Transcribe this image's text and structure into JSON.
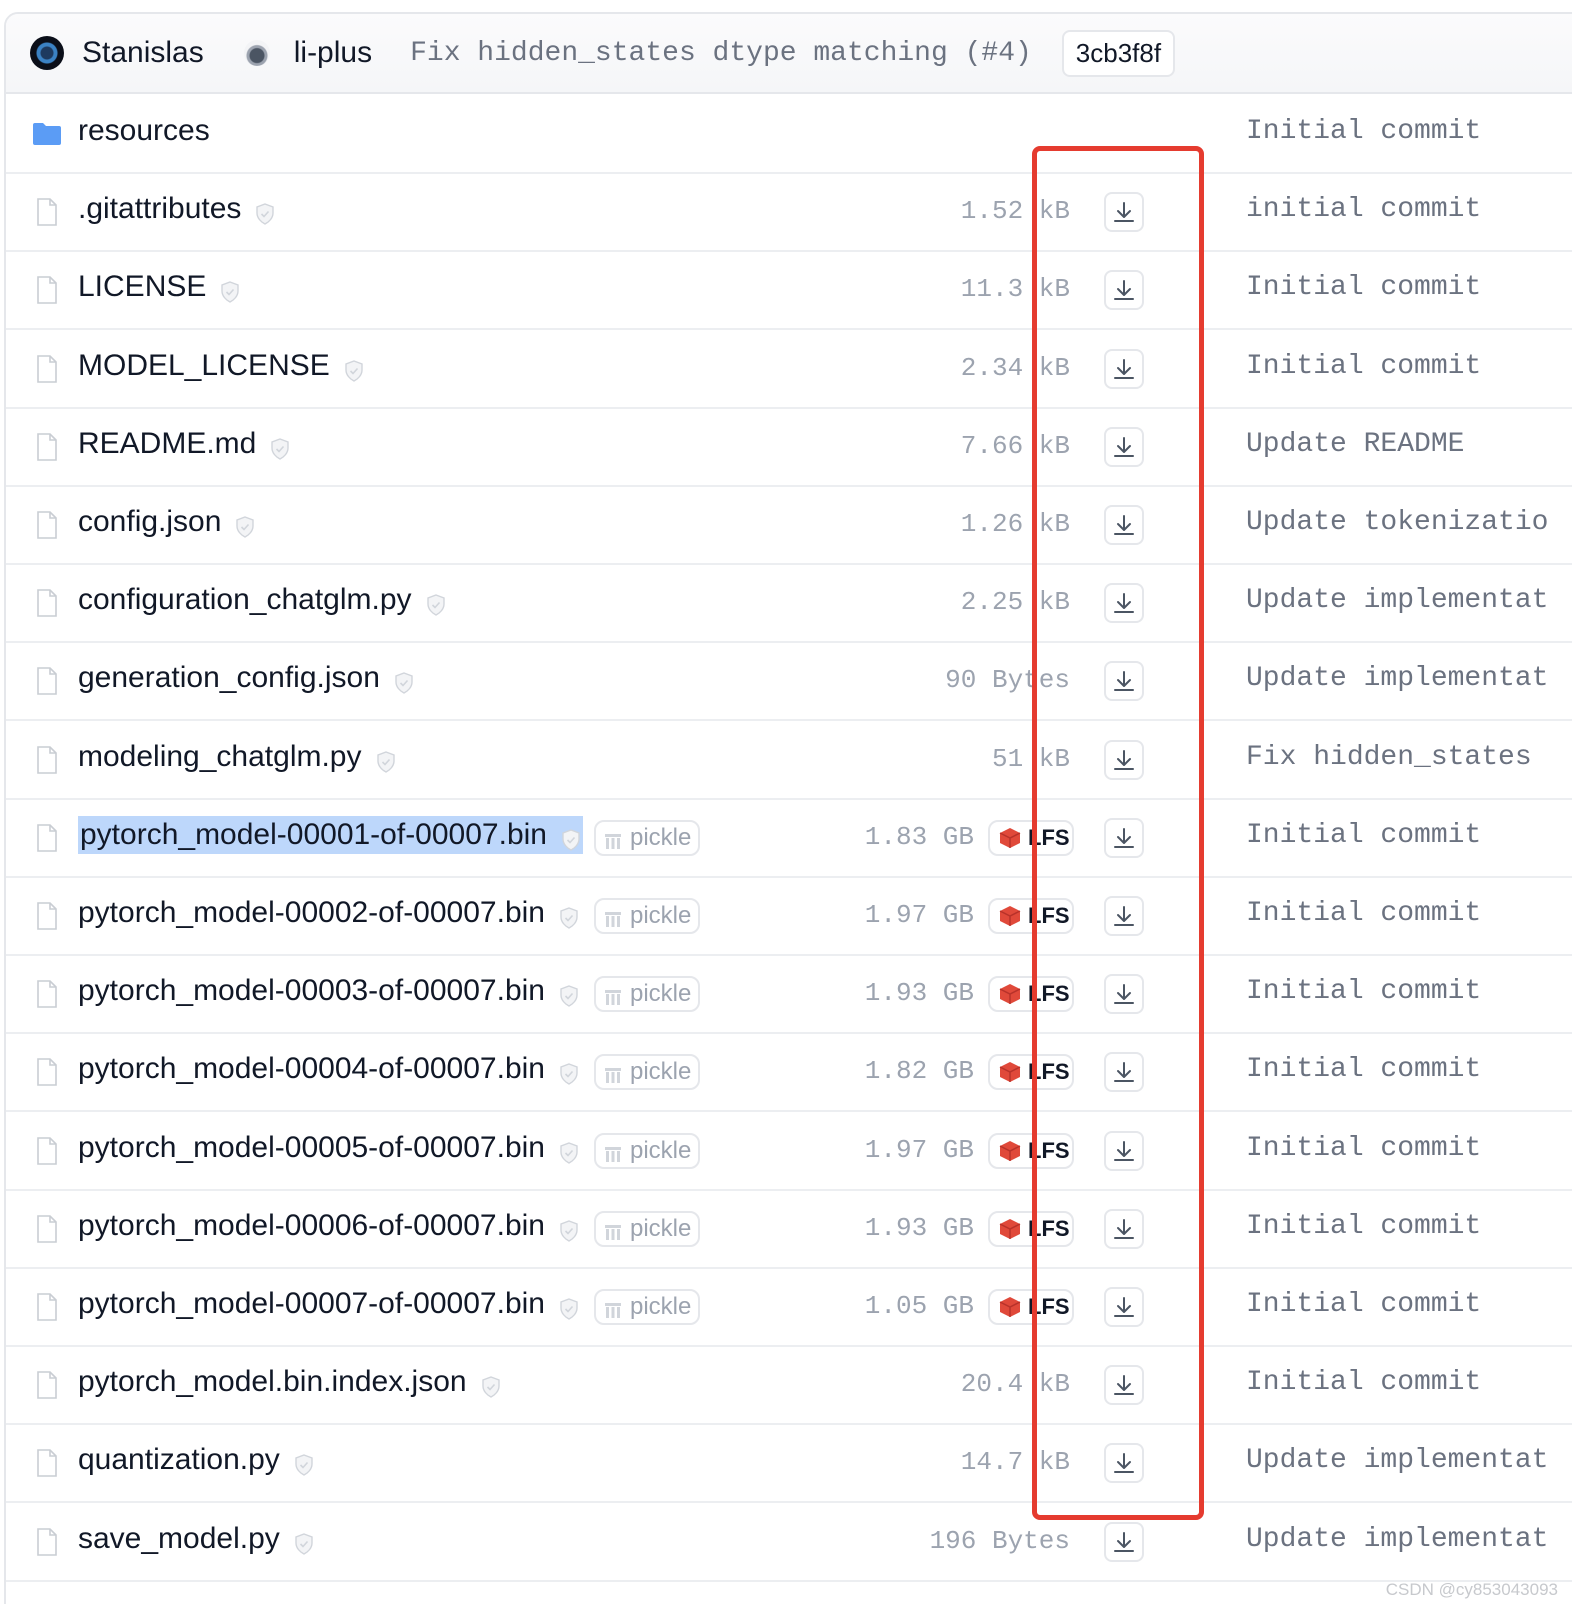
{
  "header": {
    "author1": "Stanislas",
    "author2": "li-plus",
    "commit_message": "Fix hidden_states dtype matching (#4)",
    "commit_sha": "3cb3f8f"
  },
  "files": [
    {
      "name": "resources",
      "type": "folder",
      "size": "",
      "lfs": false,
      "pickle": false,
      "message": "Initial commit",
      "selected": false
    },
    {
      "name": ".gitattributes",
      "type": "file",
      "size": "1.52 kB",
      "lfs": false,
      "pickle": false,
      "message": "initial commit",
      "selected": false
    },
    {
      "name": "LICENSE",
      "type": "file",
      "size": "11.3 kB",
      "lfs": false,
      "pickle": false,
      "message": "Initial commit",
      "selected": false
    },
    {
      "name": "MODEL_LICENSE",
      "type": "file",
      "size": "2.34 kB",
      "lfs": false,
      "pickle": false,
      "message": "Initial commit",
      "selected": false
    },
    {
      "name": "README.md",
      "type": "file",
      "size": "7.66 kB",
      "lfs": false,
      "pickle": false,
      "message": "Update README",
      "selected": false
    },
    {
      "name": "config.json",
      "type": "file",
      "size": "1.26 kB",
      "lfs": false,
      "pickle": false,
      "message": "Update tokenizatio",
      "selected": false
    },
    {
      "name": "configuration_chatglm.py",
      "type": "file",
      "size": "2.25 kB",
      "lfs": false,
      "pickle": false,
      "message": "Update implementat",
      "selected": false
    },
    {
      "name": "generation_config.json",
      "type": "file",
      "size": "90 Bytes",
      "lfs": false,
      "pickle": false,
      "message": "Update implementat",
      "selected": false
    },
    {
      "name": "modeling_chatglm.py",
      "type": "file",
      "size": "51 kB",
      "lfs": false,
      "pickle": false,
      "message": "Fix hidden_states",
      "selected": false
    },
    {
      "name": "pytorch_model-00001-of-00007.bin",
      "type": "file",
      "size": "1.83 GB",
      "lfs": true,
      "pickle": true,
      "message": "Initial commit",
      "selected": true
    },
    {
      "name": "pytorch_model-00002-of-00007.bin",
      "type": "file",
      "size": "1.97 GB",
      "lfs": true,
      "pickle": true,
      "message": "Initial commit",
      "selected": false
    },
    {
      "name": "pytorch_model-00003-of-00007.bin",
      "type": "file",
      "size": "1.93 GB",
      "lfs": true,
      "pickle": true,
      "message": "Initial commit",
      "selected": false
    },
    {
      "name": "pytorch_model-00004-of-00007.bin",
      "type": "file",
      "size": "1.82 GB",
      "lfs": true,
      "pickle": true,
      "message": "Initial commit",
      "selected": false
    },
    {
      "name": "pytorch_model-00005-of-00007.bin",
      "type": "file",
      "size": "1.97 GB",
      "lfs": true,
      "pickle": true,
      "message": "Initial commit",
      "selected": false
    },
    {
      "name": "pytorch_model-00006-of-00007.bin",
      "type": "file",
      "size": "1.93 GB",
      "lfs": true,
      "pickle": true,
      "message": "Initial commit",
      "selected": false
    },
    {
      "name": "pytorch_model-00007-of-00007.bin",
      "type": "file",
      "size": "1.05 GB",
      "lfs": true,
      "pickle": true,
      "message": "Initial commit",
      "selected": false
    },
    {
      "name": "pytorch_model.bin.index.json",
      "type": "file",
      "size": "20.4 kB",
      "lfs": false,
      "pickle": false,
      "message": "Initial commit",
      "selected": false
    },
    {
      "name": "quantization.py",
      "type": "file",
      "size": "14.7 kB",
      "lfs": false,
      "pickle": false,
      "message": "Update implementat",
      "selected": false
    },
    {
      "name": "save_model.py",
      "type": "file",
      "size": "196 Bytes",
      "lfs": false,
      "pickle": false,
      "message": "Update implementat",
      "selected": false
    }
  ],
  "labels": {
    "pickle": "pickle",
    "lfs": "LFS"
  },
  "icons": {
    "folder": "folder-icon",
    "file": "file-icon",
    "shield": "shield-check-icon",
    "download": "download-icon",
    "lfs": "lfs-cube-icon",
    "pickle": "pickle-icon"
  },
  "colors": {
    "highlight_box": "#e53b2f",
    "selection": "#bdd7fb",
    "folder": "#5b9cf5"
  },
  "watermark": "CSDN @cy853043093"
}
